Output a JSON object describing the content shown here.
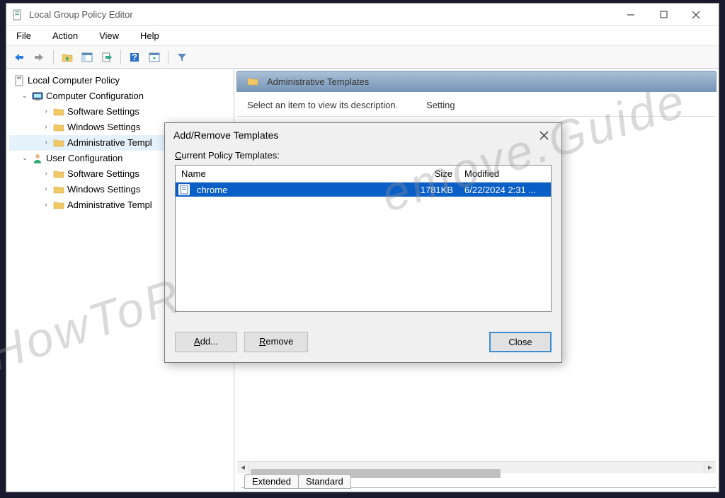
{
  "window": {
    "title": "Local Group Policy Editor"
  },
  "menubar": [
    "File",
    "Action",
    "View",
    "Help"
  ],
  "tree": {
    "root": "Local Computer Policy",
    "computer_config": "Computer Configuration",
    "cc_software": "Software Settings",
    "cc_windows": "Windows Settings",
    "cc_admin": "Administrative Templ",
    "user_config": "User Configuration",
    "uc_software": "Software Settings",
    "uc_windows": "Windows Settings",
    "uc_admin": "Administrative Templ"
  },
  "right": {
    "header": "Administrative Templates",
    "desc": "Select an item to view its description.",
    "col_setting": "Setting"
  },
  "tabs": {
    "extended": "Extended",
    "standard": "Standard"
  },
  "dialog": {
    "title": "Add/Remove Templates",
    "label": "Current Policy Templates:",
    "col_name": "Name",
    "col_size": "Size",
    "col_modified": "Modified",
    "row": {
      "name": "chrome",
      "size": "1781KB",
      "modified": "6/22/2024 2:31 ..."
    },
    "btn_add": "Add...",
    "btn_remove": "Remove",
    "btn_close": "Close"
  },
  "watermark": {
    "part1": "HowToR",
    "part2": "emove.Guide"
  }
}
